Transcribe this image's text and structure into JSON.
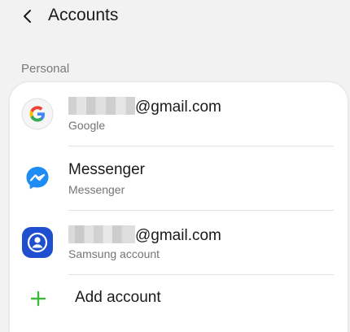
{
  "header": {
    "title": "Accounts",
    "back_icon": "back-arrow-icon"
  },
  "section": {
    "label": "Personal"
  },
  "accounts": [
    {
      "email_suffix": "@gmail.com",
      "type": "Google",
      "icon": "google-icon"
    },
    {
      "name": "Messenger",
      "type": "Messenger",
      "icon": "messenger-icon"
    },
    {
      "email_suffix": "@gmail.com",
      "type": "Samsung account",
      "icon": "samsung-account-icon"
    }
  ],
  "add_account": {
    "label": "Add account",
    "icon": "plus-icon"
  },
  "colors": {
    "background": "#f2f2f2",
    "card": "#ffffff",
    "accent_green": "#3dba3d",
    "messenger_blue": "#1f8cf5",
    "samsung_blue": "#1f4fcf"
  }
}
